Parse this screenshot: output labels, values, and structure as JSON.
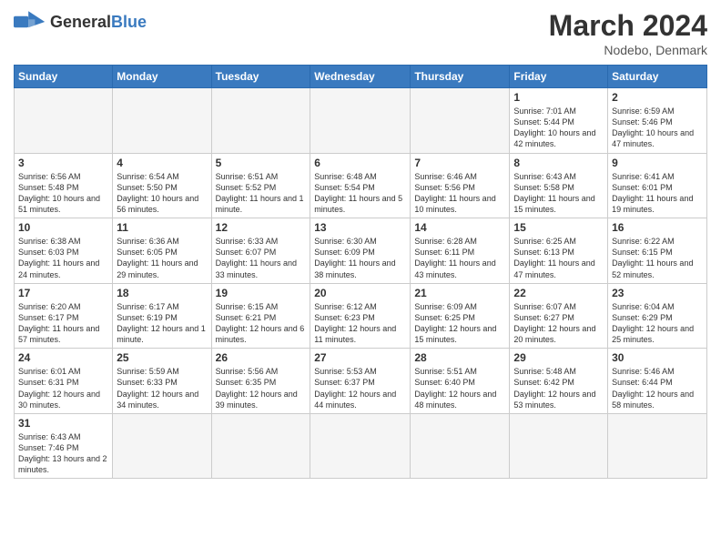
{
  "header": {
    "logo_general": "General",
    "logo_blue": "Blue",
    "month_title": "March 2024",
    "subtitle": "Nodebo, Denmark"
  },
  "weekdays": [
    "Sunday",
    "Monday",
    "Tuesday",
    "Wednesday",
    "Thursday",
    "Friday",
    "Saturday"
  ],
  "weeks": [
    [
      {
        "day": "",
        "info": "",
        "empty": true
      },
      {
        "day": "",
        "info": "",
        "empty": true
      },
      {
        "day": "",
        "info": "",
        "empty": true
      },
      {
        "day": "",
        "info": "",
        "empty": true
      },
      {
        "day": "",
        "info": "",
        "empty": true
      },
      {
        "day": "1",
        "info": "Sunrise: 7:01 AM\nSunset: 5:44 PM\nDaylight: 10 hours\nand 42 minutes."
      },
      {
        "day": "2",
        "info": "Sunrise: 6:59 AM\nSunset: 5:46 PM\nDaylight: 10 hours\nand 47 minutes."
      }
    ],
    [
      {
        "day": "3",
        "info": "Sunrise: 6:56 AM\nSunset: 5:48 PM\nDaylight: 10 hours\nand 51 minutes."
      },
      {
        "day": "4",
        "info": "Sunrise: 6:54 AM\nSunset: 5:50 PM\nDaylight: 10 hours\nand 56 minutes."
      },
      {
        "day": "5",
        "info": "Sunrise: 6:51 AM\nSunset: 5:52 PM\nDaylight: 11 hours\nand 1 minute."
      },
      {
        "day": "6",
        "info": "Sunrise: 6:48 AM\nSunset: 5:54 PM\nDaylight: 11 hours\nand 5 minutes."
      },
      {
        "day": "7",
        "info": "Sunrise: 6:46 AM\nSunset: 5:56 PM\nDaylight: 11 hours\nand 10 minutes."
      },
      {
        "day": "8",
        "info": "Sunrise: 6:43 AM\nSunset: 5:58 PM\nDaylight: 11 hours\nand 15 minutes."
      },
      {
        "day": "9",
        "info": "Sunrise: 6:41 AM\nSunset: 6:01 PM\nDaylight: 11 hours\nand 19 minutes."
      }
    ],
    [
      {
        "day": "10",
        "info": "Sunrise: 6:38 AM\nSunset: 6:03 PM\nDaylight: 11 hours\nand 24 minutes."
      },
      {
        "day": "11",
        "info": "Sunrise: 6:36 AM\nSunset: 6:05 PM\nDaylight: 11 hours\nand 29 minutes."
      },
      {
        "day": "12",
        "info": "Sunrise: 6:33 AM\nSunset: 6:07 PM\nDaylight: 11 hours\nand 33 minutes."
      },
      {
        "day": "13",
        "info": "Sunrise: 6:30 AM\nSunset: 6:09 PM\nDaylight: 11 hours\nand 38 minutes."
      },
      {
        "day": "14",
        "info": "Sunrise: 6:28 AM\nSunset: 6:11 PM\nDaylight: 11 hours\nand 43 minutes."
      },
      {
        "day": "15",
        "info": "Sunrise: 6:25 AM\nSunset: 6:13 PM\nDaylight: 11 hours\nand 47 minutes."
      },
      {
        "day": "16",
        "info": "Sunrise: 6:22 AM\nSunset: 6:15 PM\nDaylight: 11 hours\nand 52 minutes."
      }
    ],
    [
      {
        "day": "17",
        "info": "Sunrise: 6:20 AM\nSunset: 6:17 PM\nDaylight: 11 hours\nand 57 minutes."
      },
      {
        "day": "18",
        "info": "Sunrise: 6:17 AM\nSunset: 6:19 PM\nDaylight: 12 hours\nand 1 minute."
      },
      {
        "day": "19",
        "info": "Sunrise: 6:15 AM\nSunset: 6:21 PM\nDaylight: 12 hours\nand 6 minutes."
      },
      {
        "day": "20",
        "info": "Sunrise: 6:12 AM\nSunset: 6:23 PM\nDaylight: 12 hours\nand 11 minutes."
      },
      {
        "day": "21",
        "info": "Sunrise: 6:09 AM\nSunset: 6:25 PM\nDaylight: 12 hours\nand 15 minutes."
      },
      {
        "day": "22",
        "info": "Sunrise: 6:07 AM\nSunset: 6:27 PM\nDaylight: 12 hours\nand 20 minutes."
      },
      {
        "day": "23",
        "info": "Sunrise: 6:04 AM\nSunset: 6:29 PM\nDaylight: 12 hours\nand 25 minutes."
      }
    ],
    [
      {
        "day": "24",
        "info": "Sunrise: 6:01 AM\nSunset: 6:31 PM\nDaylight: 12 hours\nand 30 minutes."
      },
      {
        "day": "25",
        "info": "Sunrise: 5:59 AM\nSunset: 6:33 PM\nDaylight: 12 hours\nand 34 minutes."
      },
      {
        "day": "26",
        "info": "Sunrise: 5:56 AM\nSunset: 6:35 PM\nDaylight: 12 hours\nand 39 minutes."
      },
      {
        "day": "27",
        "info": "Sunrise: 5:53 AM\nSunset: 6:37 PM\nDaylight: 12 hours\nand 44 minutes."
      },
      {
        "day": "28",
        "info": "Sunrise: 5:51 AM\nSunset: 6:40 PM\nDaylight: 12 hours\nand 48 minutes."
      },
      {
        "day": "29",
        "info": "Sunrise: 5:48 AM\nSunset: 6:42 PM\nDaylight: 12 hours\nand 53 minutes."
      },
      {
        "day": "30",
        "info": "Sunrise: 5:46 AM\nSunset: 6:44 PM\nDaylight: 12 hours\nand 58 minutes."
      }
    ],
    [
      {
        "day": "31",
        "info": "Sunrise: 6:43 AM\nSunset: 7:46 PM\nDaylight: 13 hours\nand 2 minutes.",
        "last": true
      },
      {
        "day": "",
        "info": "",
        "empty": true,
        "last": true
      },
      {
        "day": "",
        "info": "",
        "empty": true,
        "last": true
      },
      {
        "day": "",
        "info": "",
        "empty": true,
        "last": true
      },
      {
        "day": "",
        "info": "",
        "empty": true,
        "last": true
      },
      {
        "day": "",
        "info": "",
        "empty": true,
        "last": true
      },
      {
        "day": "",
        "info": "",
        "empty": true,
        "last": true
      }
    ]
  ]
}
